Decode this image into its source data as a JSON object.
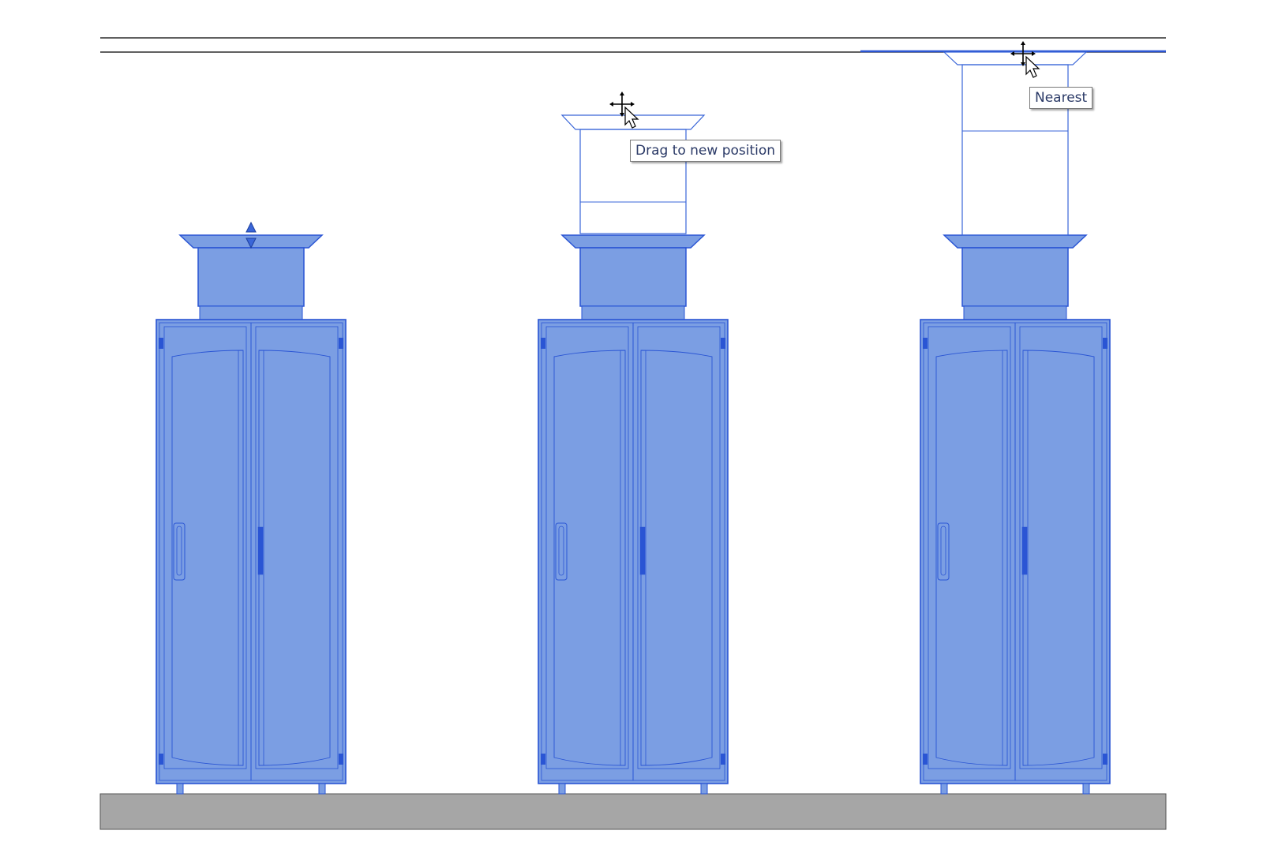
{
  "view": {
    "name": "elevation-view",
    "colors": {
      "selection_fill": "#7b9ee3",
      "selection_stroke": "#2a55d4",
      "floor_fill": "#a6a6a6",
      "ceiling_stroke": "#000000",
      "preview_stroke": "#3a66d8"
    }
  },
  "cabinets": [
    {
      "id": "cabinet-1",
      "has_flip_arrows": true,
      "state": "selected"
    },
    {
      "id": "cabinet-2",
      "has_preview_extension": true,
      "state": "dragging"
    },
    {
      "id": "cabinet-3",
      "has_preview_extension": true,
      "state": "snapping"
    }
  ],
  "tooltips": {
    "drag": "Drag to new position",
    "snap": "Nearest"
  },
  "icons": {
    "flip": "up-down-arrow-icon",
    "move_cursor": "move-cursor-icon"
  }
}
